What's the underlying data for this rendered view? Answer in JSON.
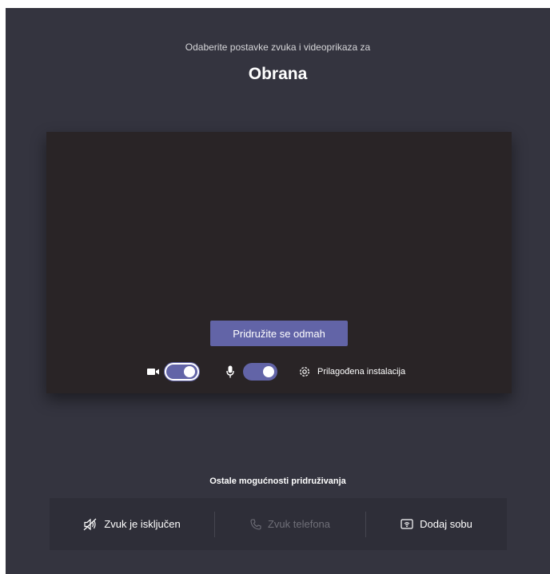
{
  "header": {
    "subtitle": "Odaberite postavke zvuka i videoprikaza za",
    "meeting_title": "Obrana"
  },
  "preview": {
    "join_button_label": "Pridružite se odmah",
    "camera": {
      "icon": "video-camera-icon",
      "enabled": true
    },
    "microphone": {
      "icon": "microphone-icon",
      "enabled": true
    },
    "custom_setup_label": "Prilagođena instalacija"
  },
  "other_options": {
    "heading": "Ostale mogućnosti pridruživanja",
    "audio_off_label": "Zvuk je isključen",
    "phone_audio_label": "Zvuk telefona",
    "add_room_label": "Dodaj sobu"
  },
  "colors": {
    "background": "#34343f",
    "preview_background": "#292426",
    "accent": "#6264a7",
    "disabled_text": "#6f6f78"
  }
}
